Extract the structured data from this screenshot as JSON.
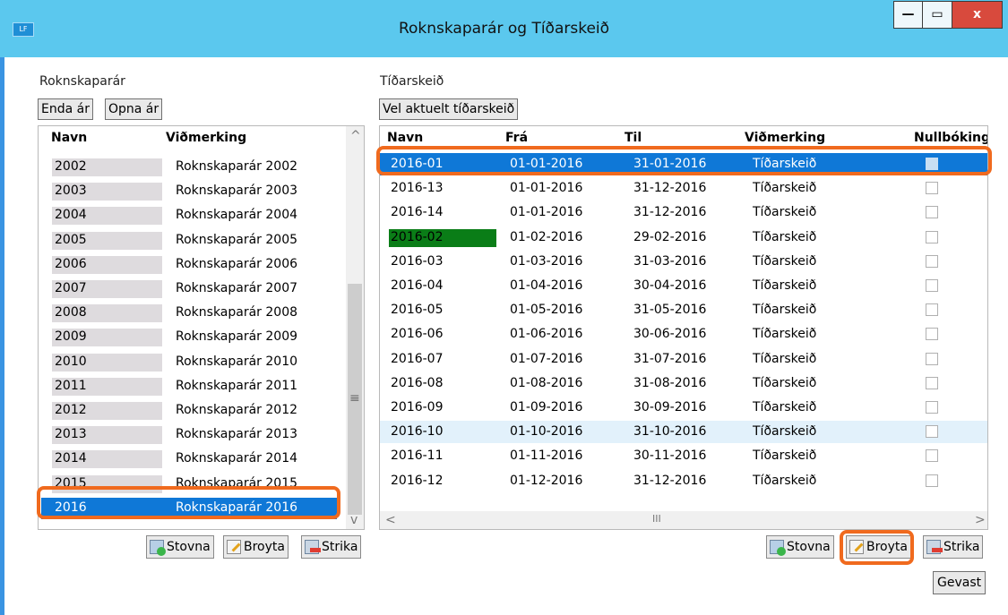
{
  "window": {
    "app_icon": "LF",
    "title": "Roknskaparár og Tíðarskeið",
    "min_glyph": "—",
    "max_glyph": "▭",
    "close_glyph": "x"
  },
  "left": {
    "section_label": "Roknskaparár",
    "end_year_button": "Enda ár",
    "open_year_button": "Opna ár",
    "columns": [
      "Navn",
      "Viðmerking"
    ],
    "rows": [
      {
        "name": "2002",
        "note": "Roknskaparár 2002"
      },
      {
        "name": "2003",
        "note": "Roknskaparár 2003"
      },
      {
        "name": "2004",
        "note": "Roknskaparár 2004"
      },
      {
        "name": "2005",
        "note": "Roknskaparár 2005"
      },
      {
        "name": "2006",
        "note": "Roknskaparár 2006"
      },
      {
        "name": "2007",
        "note": "Roknskaparár 2007"
      },
      {
        "name": "2008",
        "note": "Roknskaparár 2008"
      },
      {
        "name": "2009",
        "note": "Roknskaparár 2009"
      },
      {
        "name": "2010",
        "note": "Roknskaparár 2010"
      },
      {
        "name": "2011",
        "note": "Roknskaparár 2011"
      },
      {
        "name": "2012",
        "note": "Roknskaparár 2012"
      },
      {
        "name": "2013",
        "note": "Roknskaparár 2013"
      },
      {
        "name": "2014",
        "note": "Roknskaparár 2014"
      },
      {
        "name": "2015",
        "note": "Roknskaparár 2015"
      },
      {
        "name": "2016",
        "note": "Roknskaparár 2016"
      }
    ],
    "selected_row": 14,
    "scroll_up": "^",
    "scroll_down": "v",
    "scroll_grip": "≡",
    "buttons": {
      "add": "Stovna",
      "edit": "Broyta",
      "delete": "Strika"
    }
  },
  "right": {
    "section_label": "Tíðarskeið",
    "select_current_button": "Vel aktuelt tíðarskeið",
    "columns": [
      "Navn",
      "Frá",
      "Til",
      "Viðmerking",
      "Nullbóking"
    ],
    "rows": [
      {
        "name": "2016-01",
        "from": "01-01-2016",
        "to": "31-01-2016",
        "note": "Tíðarskeið",
        "checked": false
      },
      {
        "name": "2016-13",
        "from": "01-01-2016",
        "to": "31-12-2016",
        "note": "Tíðarskeið",
        "checked": false
      },
      {
        "name": "2016-14",
        "from": "01-01-2016",
        "to": "31-12-2016",
        "note": "Tíðarskeið",
        "checked": false
      },
      {
        "name": "2016-02",
        "from": "01-02-2016",
        "to": "29-02-2016",
        "note": "Tíðarskeið",
        "checked": false
      },
      {
        "name": "2016-03",
        "from": "01-03-2016",
        "to": "31-03-2016",
        "note": "Tíðarskeið",
        "checked": false
      },
      {
        "name": "2016-04",
        "from": "01-04-2016",
        "to": "30-04-2016",
        "note": "Tíðarskeið",
        "checked": false
      },
      {
        "name": "2016-05",
        "from": "01-05-2016",
        "to": "31-05-2016",
        "note": "Tíðarskeið",
        "checked": false
      },
      {
        "name": "2016-06",
        "from": "01-06-2016",
        "to": "30-06-2016",
        "note": "Tíðarskeið",
        "checked": false
      },
      {
        "name": "2016-07",
        "from": "01-07-2016",
        "to": "31-07-2016",
        "note": "Tíðarskeið",
        "checked": false
      },
      {
        "name": "2016-08",
        "from": "01-08-2016",
        "to": "31-08-2016",
        "note": "Tíðarskeið",
        "checked": false
      },
      {
        "name": "2016-09",
        "from": "01-09-2016",
        "to": "30-09-2016",
        "note": "Tíðarskeið",
        "checked": false
      },
      {
        "name": "2016-10",
        "from": "01-10-2016",
        "to": "31-10-2016",
        "note": "Tíðarskeið",
        "checked": false
      },
      {
        "name": "2016-11",
        "from": "01-11-2016",
        "to": "30-11-2016",
        "note": "Tíðarskeið",
        "checked": false
      },
      {
        "name": "2016-12",
        "from": "01-12-2016",
        "to": "31-12-2016",
        "note": "Tíðarskeið",
        "checked": false
      }
    ],
    "selected_row": 0,
    "hover_row": 11,
    "active_row": 3,
    "active_color": "#0a7d17",
    "scroll_left": "<",
    "scroll_right": ">",
    "scroll_grip": "III",
    "buttons": {
      "add": "Stovna",
      "edit": "Broyta",
      "delete": "Strika",
      "ignore": "Gevast"
    }
  },
  "colors": {
    "titlebar": "#5bc8ee",
    "selection": "#0f78d7",
    "highlight_outline": "#f06a1e"
  }
}
